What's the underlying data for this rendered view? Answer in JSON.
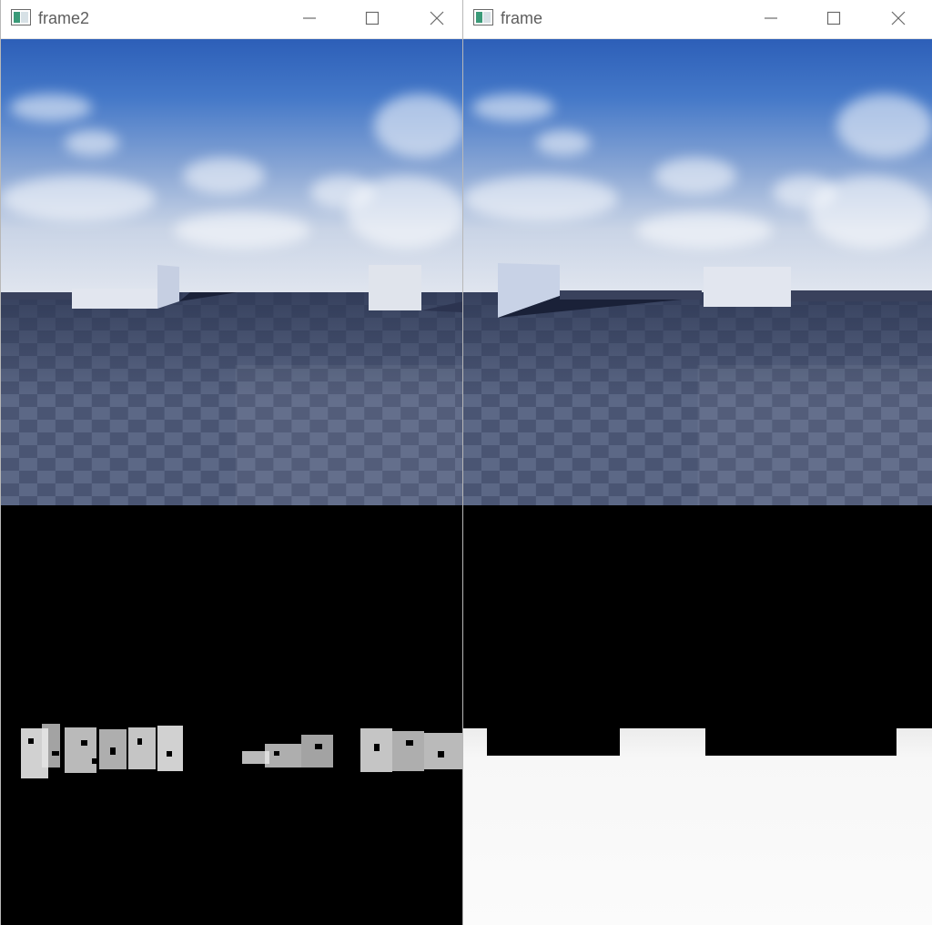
{
  "windows": [
    {
      "title": "frame2",
      "icon": "opencv-window-icon",
      "controls": [
        "minimize-icon",
        "maximize-icon",
        "close-icon"
      ],
      "panels": [
        "rgb-view",
        "disparity-view"
      ]
    },
    {
      "title": "frame",
      "icon": "opencv-window-icon",
      "controls": [
        "minimize-icon",
        "maximize-icon",
        "close-icon"
      ],
      "panels": [
        "rgb-view",
        "depth-view"
      ]
    }
  ],
  "colors": {
    "sky_top": "#2d5fb8",
    "horizon": "#e4e8f0",
    "floor_dark": "#3d4764",
    "floor_light": "#5c6886",
    "wall": "#c8d2e6",
    "depth_background": "#000000",
    "depth_foreground": "#f7f7f7"
  }
}
